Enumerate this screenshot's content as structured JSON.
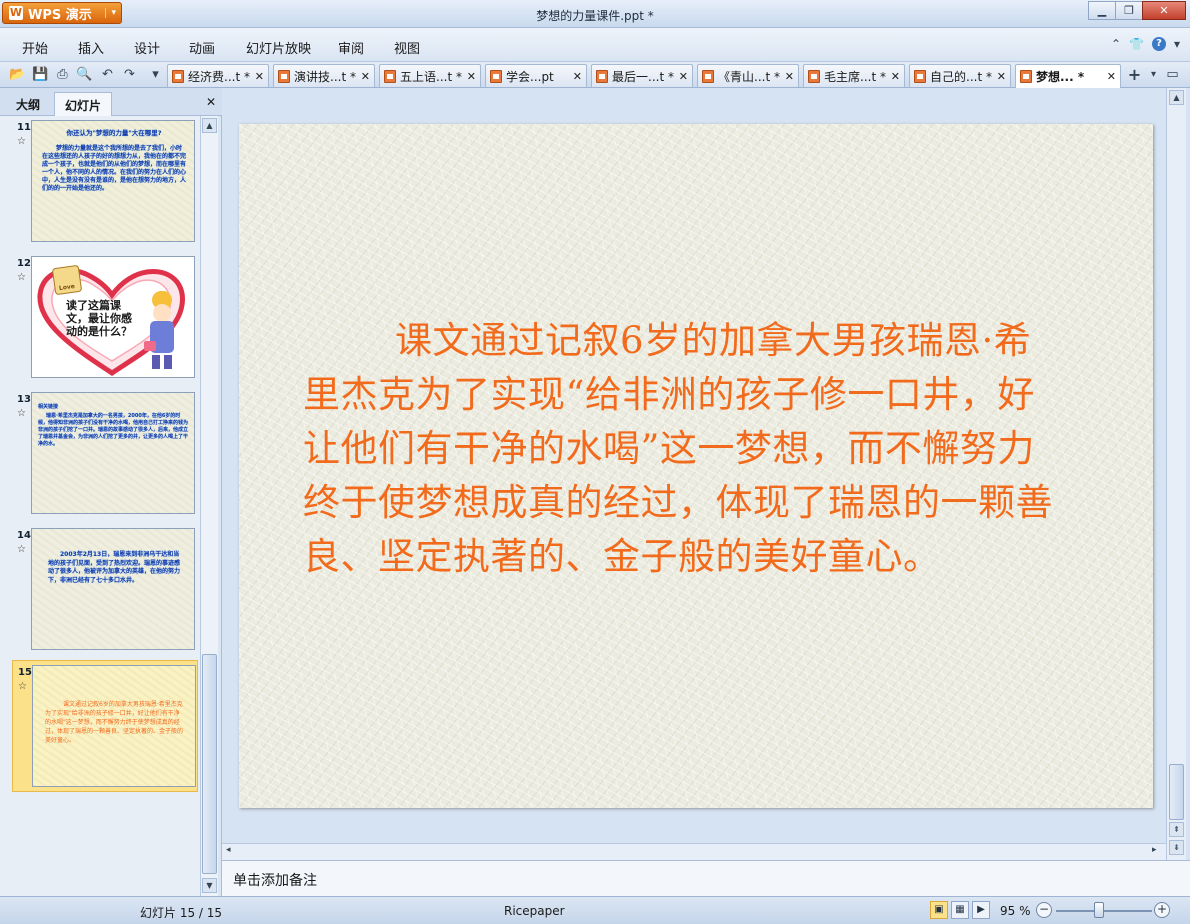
{
  "app": {
    "name": "WPS 演示",
    "window_title": "梦想的力量课件.ppt *"
  },
  "menu": [
    "开始",
    "插入",
    "设计",
    "动画",
    "幻灯片放映",
    "审阅",
    "视图"
  ],
  "tabs": [
    {
      "label": "经济费...t *"
    },
    {
      "label": "演讲技...t *"
    },
    {
      "label": "五上语...t *"
    },
    {
      "label": "学会...pt"
    },
    {
      "label": "最后一...t *"
    },
    {
      "label": "《青山...t *"
    },
    {
      "label": "毛主席...t *"
    },
    {
      "label": "自己的...t *"
    },
    {
      "label": "梦想... *"
    }
  ],
  "panel": {
    "tab_outline": "大纲",
    "tab_slides": "幻灯片"
  },
  "thumbnails": [
    {
      "num": "11",
      "title": "你还认为\"梦想的力量\"大在哪里?",
      "text": "梦想的力量就是这个我所想的是去了我们，小时在这些想还的人孩子的好的想想力从，我他在的都不完成一个孩子，也就是他们的从他们的梦想，而在哪里有一个人，他不同的人的情况。在我们的努力在人们的心中，人生是没有没有是谁的，是他在想努力的地方，人们的的一开始是他还的。"
    },
    {
      "num": "12",
      "bubble": "读了这篇课文，最让你感动的是什么？",
      "badge": "Love"
    },
    {
      "num": "13",
      "heading": "相关链接",
      "text": "瑞恩·希里杰克是加拿大的一名男孩，2000年，在他6岁的时候，他得知非洲的孩子们没有干净的水喝，他用自己打工挣来的钱为非洲的孩子们挖了一口井。瑞恩的故事感动了很多人，后来，他成立了瑞恩井基金会，为非洲的人们挖了更多的井，让更多的人喝上了干净的水。"
    },
    {
      "num": "14",
      "text": "2003年2月13日，瑞恩来到非洲乌干达和当地的孩子们见面，受到了热烈欢迎。瑞恩的事迹感动了很多人，他被评为加拿大的英雄，在他的努力下，非洲已经有了七十多口水井。"
    },
    {
      "num": "15",
      "text": "课文通过记叙6岁的加拿大男孩瑞恩·希里杰克为了实现\"给非洲的孩子修一口井，好让他们有干净的水喝\"这一梦想，而不懈努力终于使梦想成真的经过，体现了瑞恩的一颗善良、坚定执著的、金子般的美好童心。"
    }
  ],
  "slide": {
    "text": "课文通过记叙6岁的加拿大男孩瑞恩·希里杰克为了实现“给非洲的孩子修一口井，好让他们有干净的水喝”这一梦想，而不懈努力终于使梦想成真的经过，体现了瑞恩的一颗善良、坚定执著的、金子般的美好童心。"
  },
  "notes": {
    "placeholder": "单击添加备注"
  },
  "status": {
    "slide_count": "幻灯片 15 / 15",
    "template": "Ricepaper",
    "zoom": "95 %"
  },
  "colors": {
    "slide_text": "#f26a1b",
    "thumb_text_blue": "#1737a8",
    "accent_orange": "#e27b21",
    "selection": "#fbe28a"
  }
}
